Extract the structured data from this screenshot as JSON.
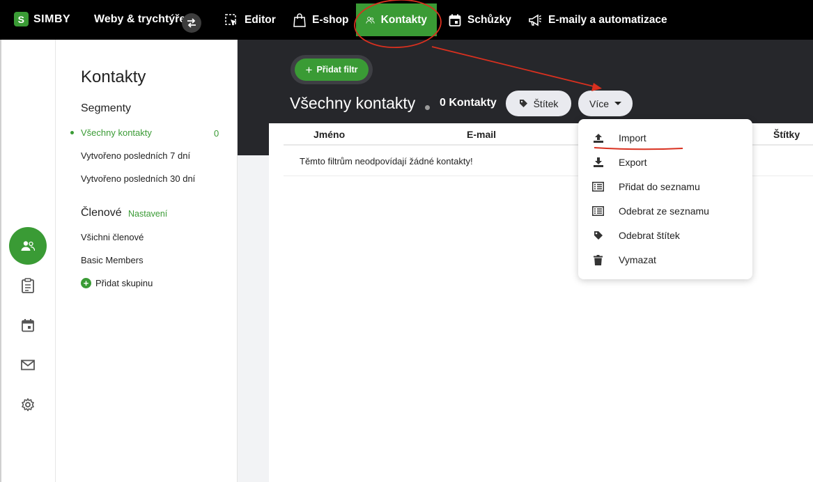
{
  "brand": {
    "name": "SIMBY",
    "mark": "S"
  },
  "topnav": {
    "site_name": "Weby & trychtýře",
    "items": [
      {
        "label": "Editor",
        "icon": "editor-icon"
      },
      {
        "label": "E-shop",
        "icon": "shopping-bag-icon"
      },
      {
        "label": "Kontakty",
        "icon": "contacts-icon",
        "active": true
      },
      {
        "label": "Schůzky",
        "icon": "calendar-icon"
      },
      {
        "label": "E-maily a automatizace",
        "icon": "megaphone-icon"
      }
    ]
  },
  "sidebar_icons": [
    "contacts-icon",
    "clipboard-icon",
    "calendar-icon",
    "mail-icon",
    "gear-icon"
  ],
  "segments": {
    "title": "Kontakty",
    "heading": "Segmenty",
    "items": [
      {
        "label": "Všechny kontakty",
        "count": "0",
        "active": true
      },
      {
        "label": "Vytvořeno posledních 7 dní"
      },
      {
        "label": "Vytvořeno posledních 30 dní"
      }
    ],
    "members_heading": "Členové",
    "members_settings": "Nastavení",
    "members": [
      {
        "label": "Všichni členové"
      },
      {
        "label": "Basic Members"
      }
    ],
    "add_group": "Přidat skupinu"
  },
  "main": {
    "add_filter": "Přidat filtr",
    "title": "Všechny kontakty",
    "count": "0 Kontakty",
    "tag_button": "Štítek",
    "more_button": "Více",
    "table": {
      "columns": [
        "Jméno",
        "E-mail",
        "Štítky"
      ],
      "empty_message": "Těmto filtrům neodpovídají žádné kontakty!"
    },
    "dropdown": [
      {
        "label": "Import",
        "icon": "upload-icon"
      },
      {
        "label": "Export",
        "icon": "download-icon"
      },
      {
        "label": "Přidat do seznamu",
        "icon": "list-icon"
      },
      {
        "label": "Odebrat ze seznamu",
        "icon": "list-icon"
      },
      {
        "label": "Odebrat štítek",
        "icon": "tag-icon"
      },
      {
        "label": "Vymazat",
        "icon": "trash-icon"
      }
    ]
  },
  "colors": {
    "accent": "#3a9b35",
    "topbar": "#000000",
    "dark_header": "#26272b",
    "annotation": "#d9301f"
  }
}
